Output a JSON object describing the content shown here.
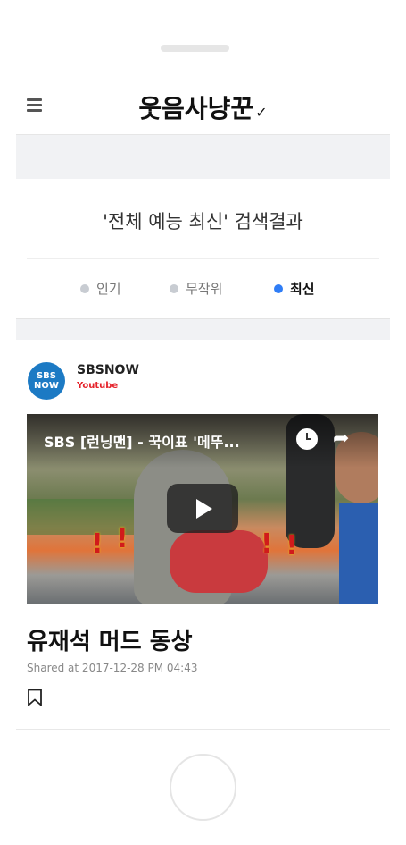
{
  "app": {
    "logo_text": "웃음사냥꾼",
    "logo_mark": "✓"
  },
  "search": {
    "result_title": "'전체 예능 최신' 검색결과"
  },
  "tabs": [
    {
      "label": "인기",
      "active": false
    },
    {
      "label": "무작위",
      "active": false
    },
    {
      "label": "최신",
      "active": true
    }
  ],
  "post": {
    "channel_avatar_text": "SBS NOW",
    "channel_name": "SBSNOW",
    "channel_source": "Youtube",
    "video_title": "SBS [런닝맨] - 꾹이표 '메뚜...",
    "title": "유재석 머드 동상",
    "shared_at": "Shared at 2017-12-28 PM 04:43"
  },
  "icons": {
    "menu": "hamburger-menu-icon",
    "clock": "watch-later-icon",
    "share": "share-arrow-icon",
    "play": "play-icon",
    "bookmark": "bookmark-icon"
  },
  "colors": {
    "accent": "#2f7df6",
    "inactive_dot": "#c8ccd2",
    "source_red": "#e5222a",
    "band_gray": "#f1f2f4"
  }
}
